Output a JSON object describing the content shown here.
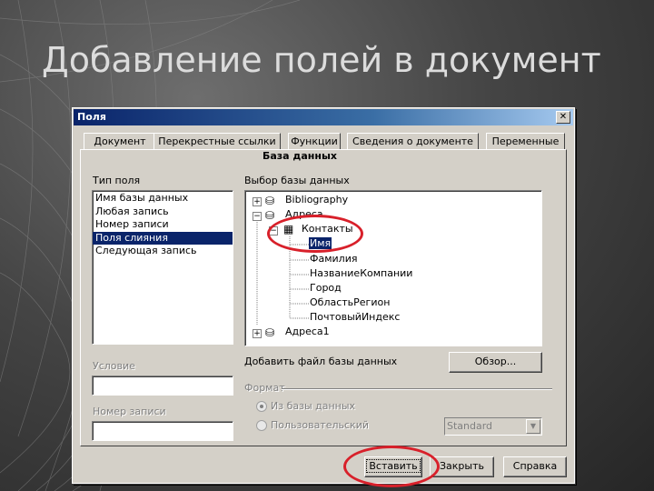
{
  "slide": {
    "title": "Добавление полей в документ"
  },
  "dialog": {
    "title": "Поля",
    "tabs": [
      {
        "label": "Документ"
      },
      {
        "label": "Перекрестные ссылки"
      },
      {
        "label": "Функции"
      },
      {
        "label": "Сведения о документе"
      },
      {
        "label": "Переменные"
      },
      {
        "label": "База данных"
      }
    ],
    "field_type": {
      "label": "Тип поля",
      "items": [
        "Имя базы данных",
        "Любая запись",
        "Номер записи",
        "Поля слияния",
        "Следующая запись"
      ],
      "selected_index": 3
    },
    "condition": {
      "label": "Условие",
      "value": ""
    },
    "record_number": {
      "label": "Номер записи",
      "value": ""
    },
    "database_selection": {
      "label": "Выбор базы данных",
      "tree": [
        {
          "label": "Bibliography",
          "expander": "+",
          "icon": "database-icon"
        },
        {
          "label": "Адреса",
          "expander": "−",
          "icon": "database-icon"
        },
        {
          "label": "Контакты",
          "expander": "−",
          "icon": "table-icon"
        },
        {
          "label": "Имя",
          "selected": true
        },
        {
          "label": "Фамилия"
        },
        {
          "label": "НазваниеКомпании"
        },
        {
          "label": "Город"
        },
        {
          "label": "ОбластьРегион"
        },
        {
          "label": "ПочтовыйИндекс"
        },
        {
          "label": "Адреса1",
          "expander": "+",
          "icon": "database-icon"
        }
      ]
    },
    "add_database": {
      "label": "Добавить файл базы данных",
      "browse_button": "Обзор..."
    },
    "format": {
      "label": "Формат",
      "option_from_db": "Из базы данных",
      "option_custom": "Пользовательский",
      "combo_value": "Standard"
    },
    "buttons": {
      "insert": "Вставить",
      "close": "Закрыть",
      "help": "Справка"
    },
    "highlight_color": "#d8202a"
  }
}
